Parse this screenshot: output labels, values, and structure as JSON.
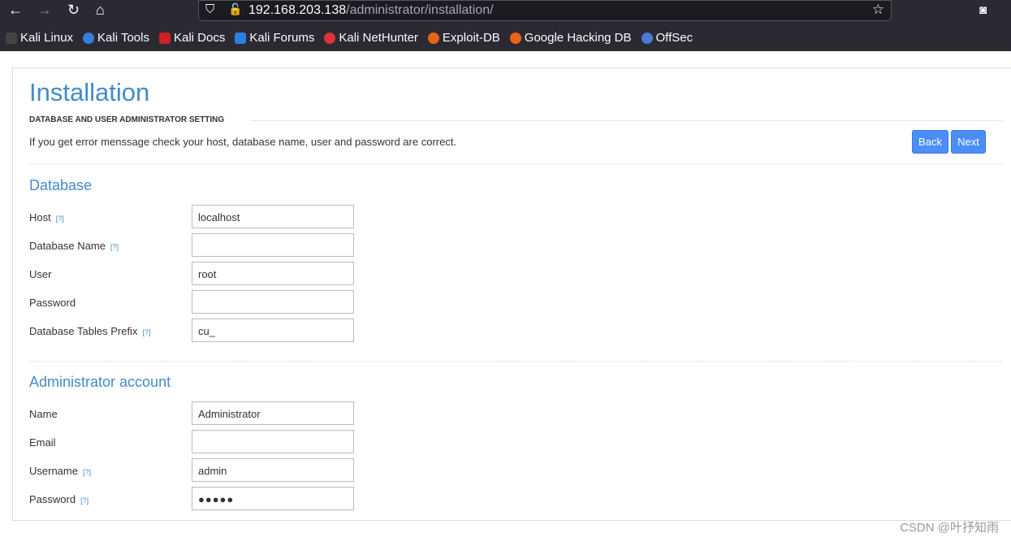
{
  "browser": {
    "url_host": "192.168.203.138",
    "url_path": "/administrator/installation/",
    "bookmarks": [
      "Kali Linux",
      "Kali Tools",
      "Kali Docs",
      "Kali Forums",
      "Kali NetHunter",
      "Exploit-DB",
      "Google Hacking DB",
      "OffSec"
    ]
  },
  "page": {
    "title": "Installation",
    "subtitle": "DATABASE AND USER ADMINISTRATOR SETTING",
    "hint": "If you get error menssage check your host, database name, user and password are correct.",
    "back": "Back",
    "next": "Next",
    "help": "[?]",
    "db_heading": "Database",
    "admin_heading": "Administrator account",
    "db_fields": [
      {
        "label": "Host",
        "value": "localhost"
      },
      {
        "label": "Database Name",
        "value": ""
      },
      {
        "label": "User",
        "value": "root"
      },
      {
        "label": "Password",
        "value": ""
      },
      {
        "label": "Database Tables Prefix",
        "value": "cu_"
      }
    ],
    "admin_fields": [
      {
        "label": "Name",
        "value": "Administrator"
      },
      {
        "label": "Email",
        "value": ""
      },
      {
        "label": "Username",
        "value": "admin"
      },
      {
        "label": "Password",
        "value": "●●●●●"
      }
    ]
  },
  "watermark": "CSDN @叶抒知雨"
}
